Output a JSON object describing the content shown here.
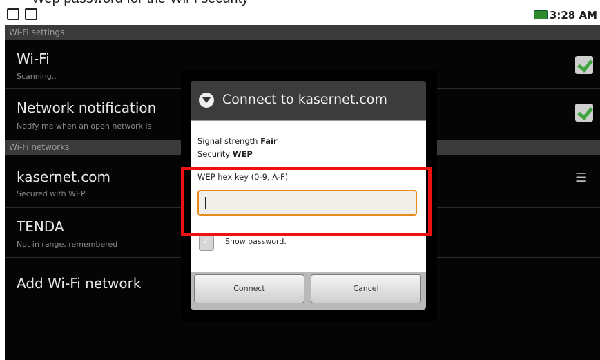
{
  "caption": {
    "text": "Wep password for the WiFi security"
  },
  "status_bar": {
    "clock": "3:28 AM",
    "icons": [
      "sd-card-icon",
      "usb-debug-icon"
    ],
    "battery_color": "#2d8a2d"
  },
  "settings": {
    "header_wifi_settings": "Wi-Fi settings",
    "wifi": {
      "title": "Wi-Fi",
      "subtitle": "Scanning..",
      "checked": true
    },
    "network_notification": {
      "title": "Network notification",
      "subtitle": "Notify me when an open network is",
      "checked": true
    },
    "header_wifi_networks": "Wi-Fi networks",
    "networks": [
      {
        "title": "kasernet.com",
        "subtitle": "Secured with WEP"
      },
      {
        "title": "TENDA",
        "subtitle": "Not in range, remembered"
      }
    ],
    "add_network": "Add Wi-Fi network"
  },
  "dialog": {
    "title": "Connect to kasernet.com",
    "signal_label": "Signal strength",
    "signal_value": "Fair",
    "security_label": "Security",
    "security_value": "WEP",
    "key_label": "WEP hex key (0-9, A-F)",
    "key_value": "",
    "show_password_label": "Show password.",
    "connect_label": "Connect",
    "cancel_label": "Cancel"
  },
  "colors": {
    "highlight": "#ee1111",
    "input_focus": "#e88a1a",
    "check_green": "#3fa53f"
  }
}
